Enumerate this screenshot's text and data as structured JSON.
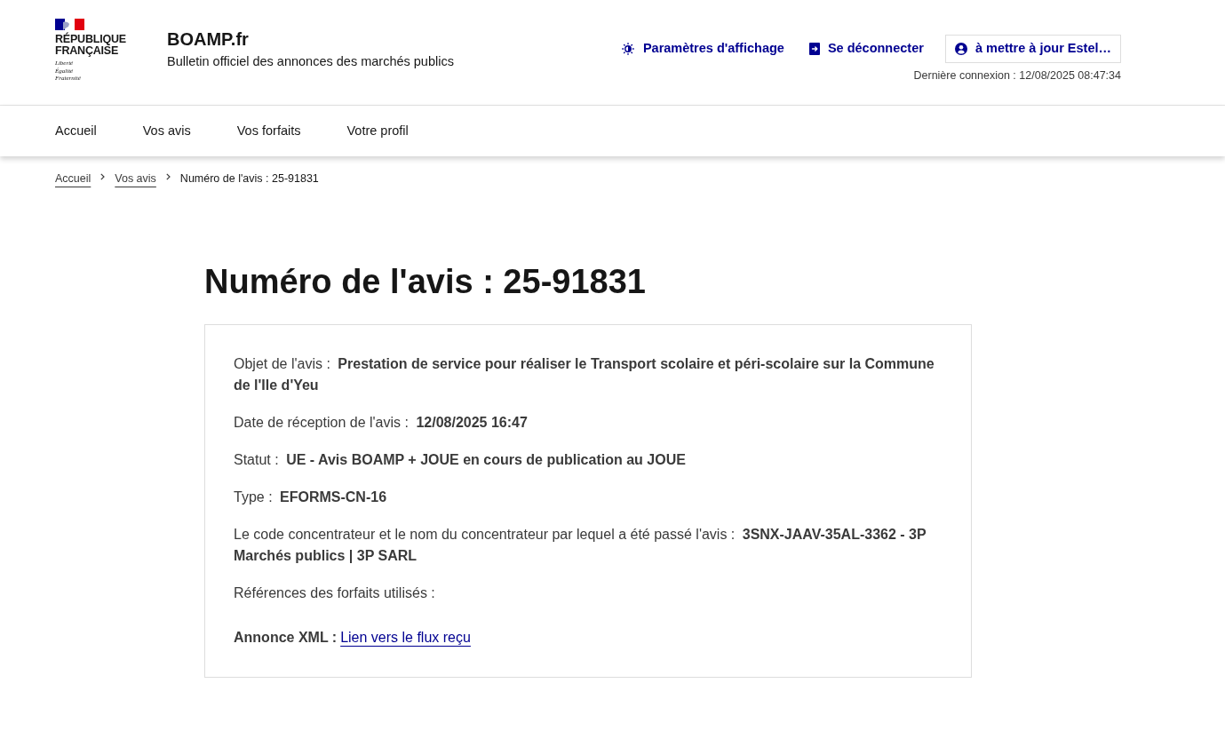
{
  "header": {
    "logo": {
      "name_lines": [
        "RÉPUBLIQUE",
        "FRANÇAISE"
      ],
      "motto_lines": [
        "Liberté",
        "Égalité",
        "Fraternité"
      ]
    },
    "site_title": "BOAMP.fr",
    "site_subtitle": "Bulletin officiel des annonces des marchés publics",
    "tools": [
      {
        "kind": "display-settings",
        "label": "Paramètres d'affichage"
      },
      {
        "kind": "logout",
        "label": "Se déconnecter"
      },
      {
        "kind": "account",
        "label": "à mettre à jour Estel…"
      }
    ],
    "last_login": "Dernière connexion : 12/08/2025 08:47:34"
  },
  "nav": {
    "items": [
      {
        "label": "Accueil"
      },
      {
        "label": "Vos avis"
      },
      {
        "label": "Vos forfaits"
      },
      {
        "label": "Votre profil"
      }
    ]
  },
  "breadcrumb": {
    "items": [
      {
        "kind": "link",
        "label": "Accueil"
      },
      {
        "kind": "link",
        "label": "Vos avis"
      },
      {
        "kind": "current",
        "label": "Numéro de l'avis : 25-91831"
      }
    ]
  },
  "page_title": "Numéro de l'avis : 25-91831",
  "details": [
    {
      "kind": "text",
      "text": "Objet de l'avis : **Prestation de service pour réaliser le Transport scolaire et péri-scolaire sur la Commune de l'Ile d'Yeu**"
    },
    {
      "kind": "text",
      "text": "Date de réception de l'avis : **12/08/2025 16:47**"
    },
    {
      "kind": "text",
      "text": "Statut : **UE - Avis BOAMP + JOUE en cours de publication au JOUE**"
    },
    {
      "kind": "text",
      "text": "Type : **EFORMS-CN-16**"
    },
    {
      "kind": "text",
      "text": "Le code concentrateur et le nom du concentrateur par lequel a été passé l'avis : **3SNX-JAAV-35AL-3362 - 3P Marchés publics | 3P SARL**"
    },
    {
      "kind": "text",
      "text": "Références des forfaits utilisés :"
    },
    {
      "kind": "link",
      "label": "Annonce XML :",
      "link": "Lien vers le flux reçu"
    }
  ]
}
